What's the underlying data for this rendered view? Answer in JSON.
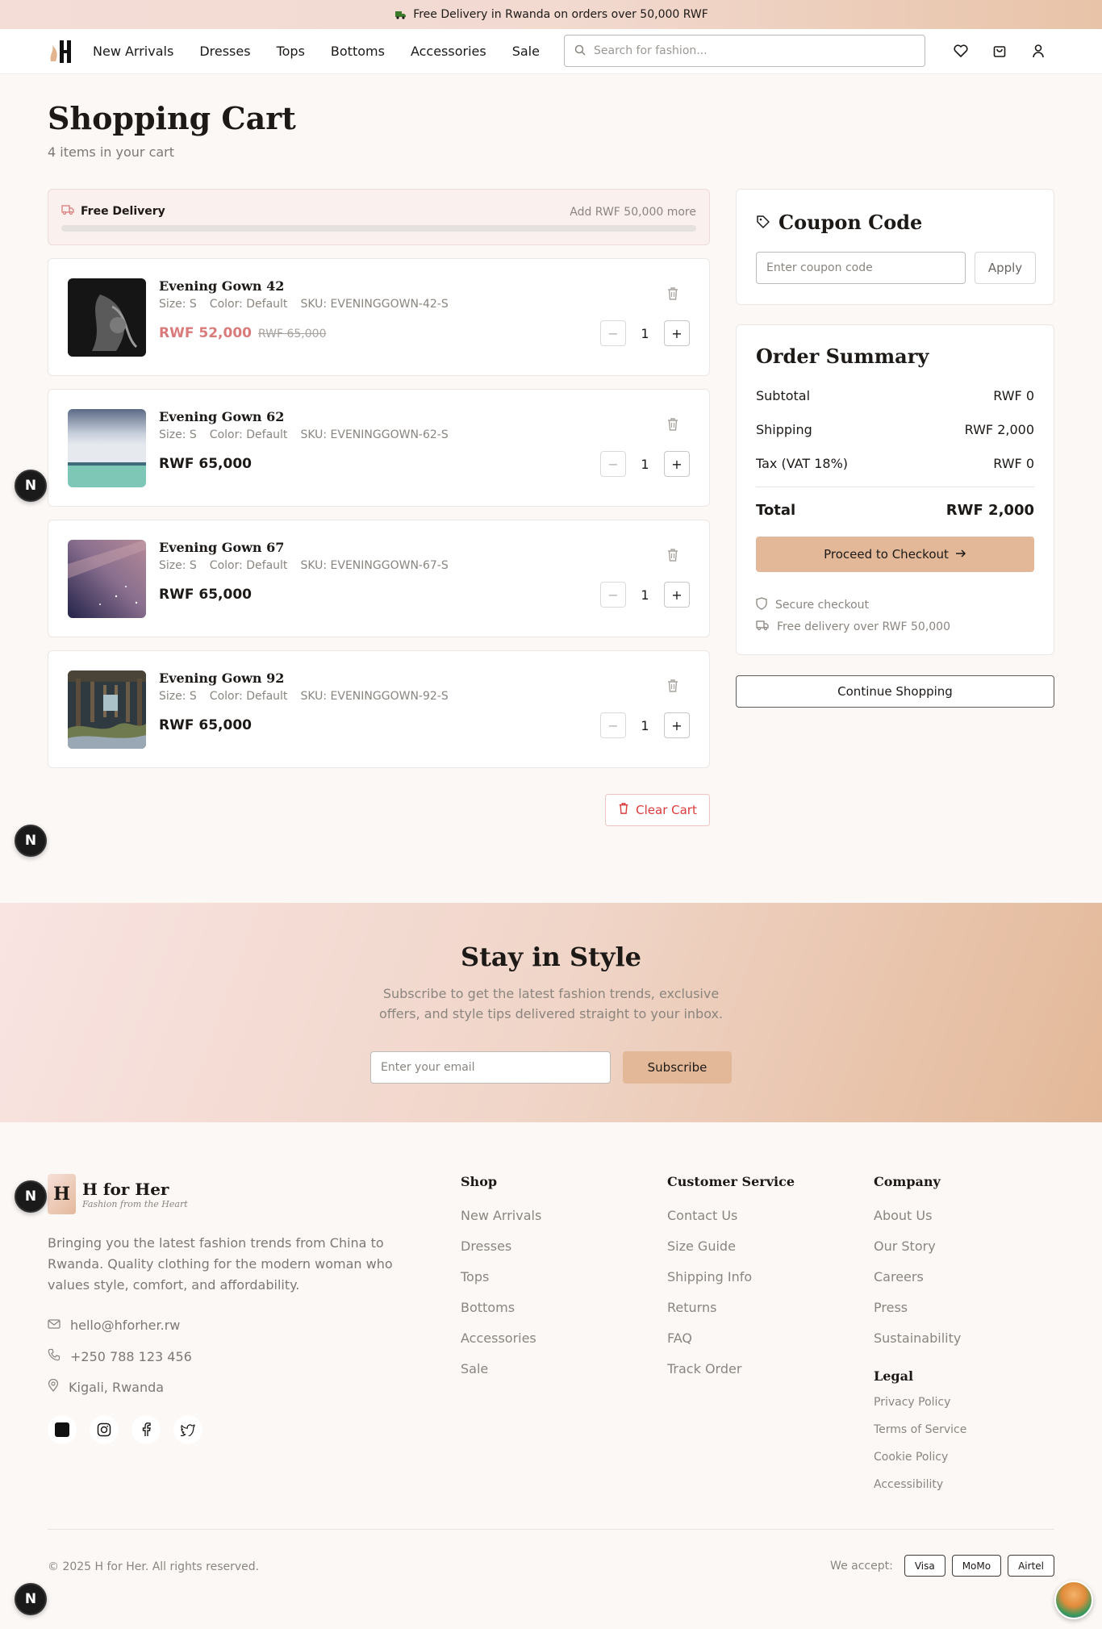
{
  "announcement": {
    "text": "Free Delivery in Rwanda on orders over 50,000 RWF",
    "icon": "truck-icon"
  },
  "header": {
    "nav": [
      "New Arrivals",
      "Dresses",
      "Tops",
      "Bottoms",
      "Accessories",
      "Sale"
    ],
    "search_placeholder": "Search for fashion...",
    "icons": [
      "heart-icon",
      "shopping-bag-icon",
      "user-icon"
    ]
  },
  "page": {
    "title": "Shopping Cart",
    "subtitle": "4 items in your cart"
  },
  "delivery": {
    "label": "Free Delivery",
    "remaining": "Add RWF 50,000 more",
    "progress": 0
  },
  "cart_items": [
    {
      "name": "Evening Gown 42",
      "size": "Size: S",
      "color": "Color: Default",
      "sku": "SKU: EVENINGGOWN-42-S",
      "price": "RWF 52,000",
      "old_price": "RWF 65,000",
      "qty": "1",
      "on_sale": true
    },
    {
      "name": "Evening Gown 62",
      "size": "Size: S",
      "color": "Color: Default",
      "sku": "SKU: EVENINGGOWN-62-S",
      "price": "RWF 65,000",
      "old_price": "",
      "qty": "1",
      "on_sale": false
    },
    {
      "name": "Evening Gown 67",
      "size": "Size: S",
      "color": "Color: Default",
      "sku": "SKU: EVENINGGOWN-67-S",
      "price": "RWF 65,000",
      "old_price": "",
      "qty": "1",
      "on_sale": false
    },
    {
      "name": "Evening Gown 92",
      "size": "Size: S",
      "color": "Color: Default",
      "sku": "SKU: EVENINGGOWN-92-S",
      "price": "RWF 65,000",
      "old_price": "",
      "qty": "1",
      "on_sale": false
    }
  ],
  "qty_controls": {
    "minus": "−",
    "plus": "+"
  },
  "clear_cart": "Clear Cart",
  "coupon": {
    "title": "Coupon Code",
    "placeholder": "Enter coupon code",
    "apply": "Apply"
  },
  "summary": {
    "title": "Order Summary",
    "subtotal_label": "Subtotal",
    "subtotal": "RWF 0",
    "shipping_label": "Shipping",
    "shipping": "RWF 2,000",
    "tax_label": "Tax (VAT 18%)",
    "tax": "RWF 0",
    "total_label": "Total",
    "total": "RWF 2,000",
    "checkout": "Proceed to Checkout",
    "secure": "Secure checkout",
    "free_delivery": "Free delivery over RWF 50,000"
  },
  "continue_shopping": "Continue Shopping",
  "newsletter": {
    "title": "Stay in Style",
    "subtitle": "Subscribe to get the latest fashion trends, exclusive offers, and style tips delivered straight to your inbox.",
    "placeholder": "Enter your email",
    "button": "Subscribe"
  },
  "footer": {
    "brand_letter": "H",
    "brand_name": "H for Her",
    "tagline": "Fashion from the Heart",
    "description": "Bringing you the latest fashion trends from China to Rwanda. Quality clothing for the modern woman who values style, comfort, and affordability.",
    "email": "hello@hforher.rw",
    "phone": "+250 788 123 456",
    "location": "Kigali, Rwanda",
    "shop": {
      "title": "Shop",
      "links": [
        "New Arrivals",
        "Dresses",
        "Tops",
        "Bottoms",
        "Accessories",
        "Sale"
      ]
    },
    "service": {
      "title": "Customer Service",
      "links": [
        "Contact Us",
        "Size Guide",
        "Shipping Info",
        "Returns",
        "FAQ",
        "Track Order"
      ]
    },
    "company": {
      "title": "Company",
      "links": [
        "About Us",
        "Our Story",
        "Careers",
        "Press",
        "Sustainability"
      ]
    },
    "legal": {
      "title": "Legal",
      "links": [
        "Privacy Policy",
        "Terms of Service",
        "Cookie Policy",
        "Accessibility"
      ]
    },
    "copyright": "© 2025 H for Her. All rights reserved.",
    "we_accept": "We accept:",
    "payments": [
      "Visa",
      "MoMo",
      "Airtel"
    ]
  },
  "badge_letter": "N",
  "colors": {
    "accent": "#e3b898",
    "sale": "#d97b7b",
    "danger": "#dc3b3b",
    "text": "#1c1917",
    "muted": "#8a857f"
  }
}
